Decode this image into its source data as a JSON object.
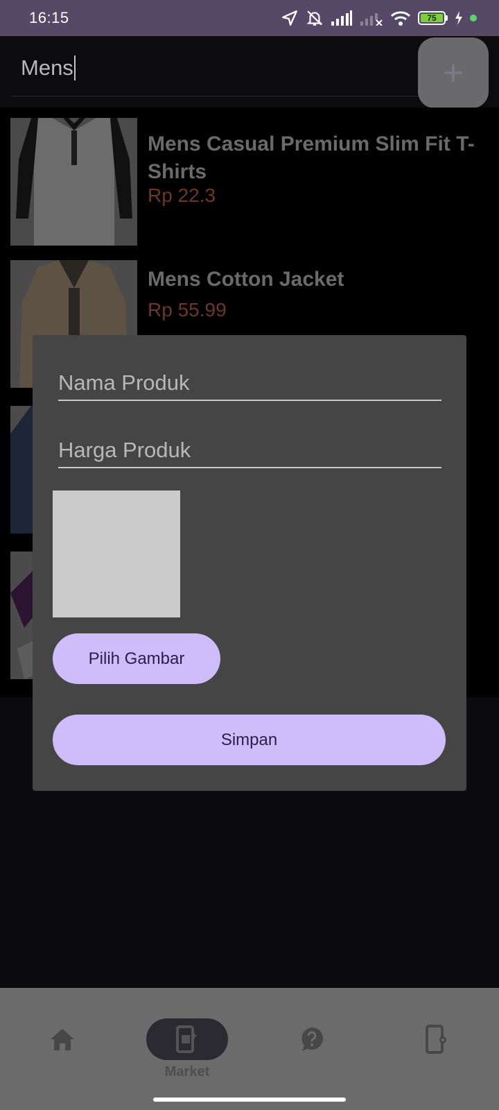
{
  "status_bar": {
    "time": "16:15",
    "battery_level": "75",
    "icons": [
      "location-arrow-icon",
      "bell-off-icon",
      "signal-icon",
      "signal-no-service-icon",
      "wifi-icon",
      "battery-icon",
      "charging-bolt-icon"
    ]
  },
  "search": {
    "value": "Mens",
    "add_icon": "plus-icon"
  },
  "products": [
    {
      "name": "Mens Casual Premium Slim Fit T-Shirts",
      "price": "Rp 22.3"
    },
    {
      "name": "Mens Cotton Jacket",
      "price": "Rp 55.99"
    }
  ],
  "dialog": {
    "name_placeholder": "Nama Produk",
    "price_placeholder": "Harga Produk",
    "pick_image_label": "Pilih Gambar",
    "save_label": "Simpan"
  },
  "bottom_nav": {
    "items": [
      {
        "icon": "home-icon",
        "label": ""
      },
      {
        "icon": "market-icon",
        "label": "Market",
        "active": true
      },
      {
        "icon": "help-icon",
        "label": ""
      },
      {
        "icon": "device-settings-icon",
        "label": ""
      }
    ]
  },
  "colors": {
    "status_bar": "#564968",
    "accent_button": "#cfbcfb",
    "dialog_bg": "#454545",
    "price_text": "#6e3626"
  }
}
